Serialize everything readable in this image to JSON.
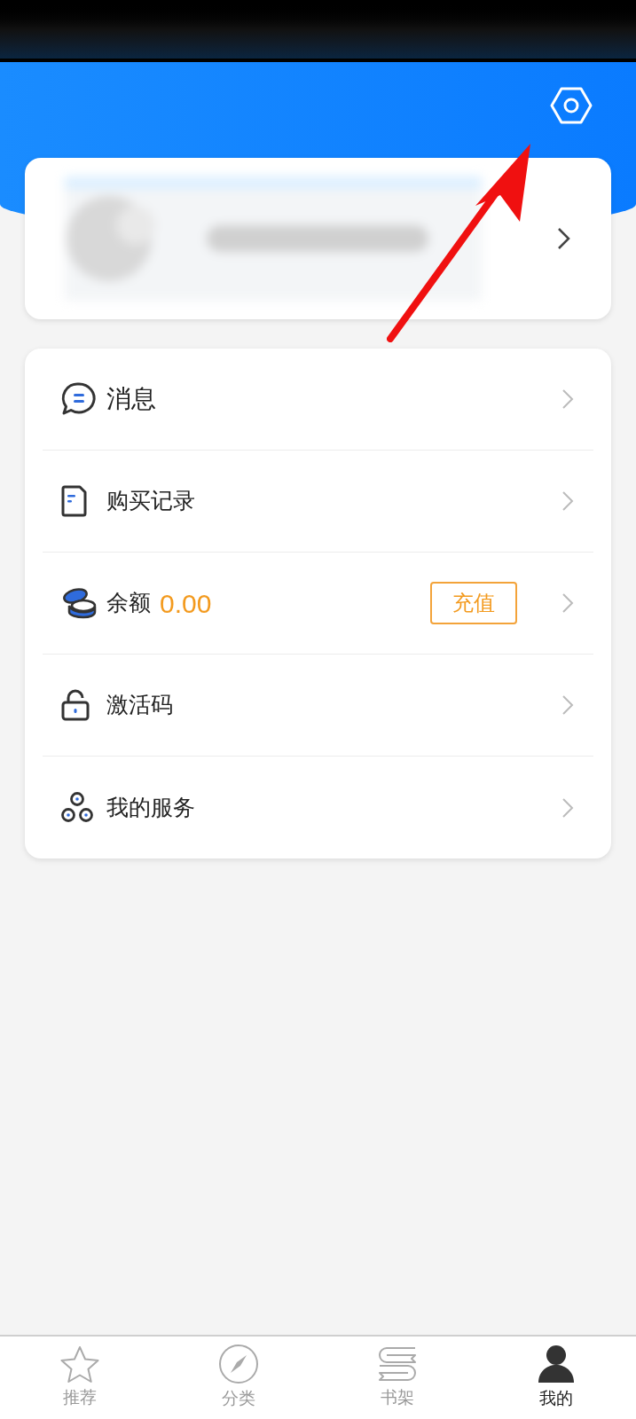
{
  "menu": [
    {
      "kind": "message",
      "label": "消息"
    },
    {
      "kind": "purchases",
      "label": "购买记录"
    },
    {
      "kind": "balance",
      "label": "余额",
      "value": "0.00",
      "action": "充值"
    },
    {
      "kind": "code",
      "label": "激活码"
    },
    {
      "kind": "services",
      "label": "我的服务"
    }
  ],
  "tabs": [
    {
      "kind": "star",
      "label": "推荐",
      "selected": false
    },
    {
      "kind": "compass",
      "label": "分类",
      "selected": false
    },
    {
      "kind": "shelf",
      "label": "书架",
      "selected": false
    },
    {
      "kind": "person",
      "label": "我的",
      "selected": true
    }
  ]
}
